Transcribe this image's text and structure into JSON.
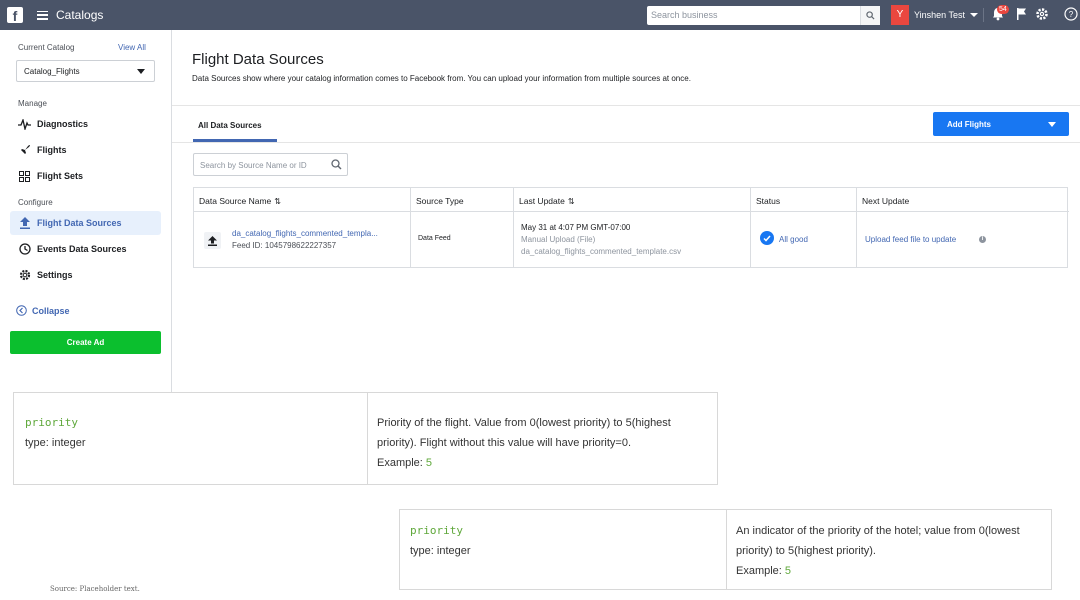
{
  "topbar": {
    "logo": "f",
    "app_title": "Catalogs",
    "search_placeholder": "Search business",
    "user_initial": "Y",
    "user_name": "Yinshen Test",
    "notification_count": "54",
    "bar_color": "#4a5468"
  },
  "sidebar": {
    "current_catalog_label": "Current Catalog",
    "view_all": "View All",
    "selected_catalog": "Catalog_Flights",
    "manage_label": "Manage",
    "manage_items": [
      {
        "label": "Diagnostics",
        "icon": "pulse-icon"
      },
      {
        "label": "Flights",
        "icon": "plane-icon"
      },
      {
        "label": "Flight Sets",
        "icon": "grid-icon"
      }
    ],
    "configure_label": "Configure",
    "configure_items": [
      {
        "label": "Flight Data Sources",
        "icon": "upload-icon",
        "active": true
      },
      {
        "label": "Events Data Sources",
        "icon": "events-icon"
      },
      {
        "label": "Settings",
        "icon": "gear-icon"
      }
    ],
    "collapse": "Collapse",
    "create_ad": "Create Ad"
  },
  "main": {
    "title": "Flight Data Sources",
    "description": "Data Sources show where your catalog information comes to Facebook from. You can upload your information from multiple sources at once.",
    "tab": "All Data Sources",
    "add_button": "Add Flights",
    "search_placeholder": "Search by Source Name or ID",
    "table": {
      "headers": [
        "Data Source Name",
        "Source Type",
        "Last Update",
        "Status",
        "Next Update"
      ],
      "row": {
        "name": "da_catalog_flights_commented_templa...",
        "feed_id": "Feed ID: 1045798622227357",
        "source_type": "Data Feed",
        "last_update_time": "May 31 at 4:07 PM GMT-07:00",
        "last_update_method": "Manual Upload (File)",
        "last_update_file": "da_catalog_flights_commented_template.csv",
        "status": "All good",
        "next_update": "Upload feed file to update"
      }
    }
  },
  "docs": [
    {
      "key": "priority",
      "type": "type: integer",
      "desc_line1": "Priority of the flight. Value from 0(lowest priority) to 5(highest",
      "desc_line2": "priority). Flight without this value will have priority=0.",
      "example_label": "Example:",
      "example_value": "5"
    },
    {
      "key": "priority",
      "type": "type: integer",
      "desc_line1": "An indicator of the priority of the hotel; value from 0(lowest",
      "desc_line2": "priority) to 5(highest priority).",
      "example_label": "Example:",
      "example_value": "5"
    }
  ],
  "source_note": "Source: Placeholder text.",
  "colors": {
    "accent": "#4267b2",
    "primary_button": "#1877f2",
    "create_ad": "#0bbf2e",
    "code_green": "#5fa83b"
  }
}
